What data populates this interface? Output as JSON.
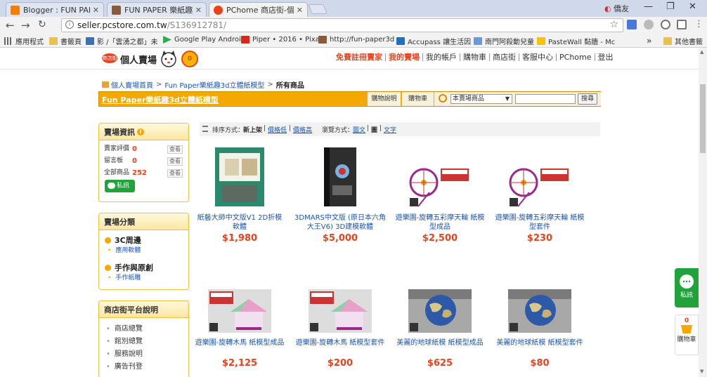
{
  "browser": {
    "tabs": [
      {
        "title": "Blogger : FUN PAPER 紙",
        "favicon_color": "#f57d00",
        "active": false
      },
      {
        "title": "FUN PAPER 樂紙趣/紙立",
        "favicon_color": "#8a5a3a",
        "active": false
      },
      {
        "title": "PChome 商店街-個人賣",
        "favicon_color": "#e8431c",
        "active": true
      }
    ],
    "user_label": "僑友",
    "url_host": "seller.pcstore.com.tw",
    "url_path": "/S136912781/",
    "bookmarks": [
      {
        "label": "應用程式",
        "icon": "apps-icon"
      },
      {
        "label": "書籤頁",
        "icon": "folder-icon"
      },
      {
        "label": "影 /「雲湧之都」未",
        "icon": "page-icon"
      },
      {
        "label": "Google Play Androi",
        "icon": "play-icon"
      },
      {
        "label": "Piper • 2016 • Pixar",
        "icon": "youtube-icon"
      },
      {
        "label": "http://fun-paper3d",
        "icon": "page-icon"
      },
      {
        "label": "Accupass 讓生活因",
        "icon": "page-icon"
      },
      {
        "label": "南門阿殺動兒童",
        "icon": "page-icon"
      },
      {
        "label": "PasteWall 黏牆 - Mc",
        "icon": "page-icon"
      },
      {
        "label": "其他書籤",
        "icon": "folder-icon"
      }
    ]
  },
  "site": {
    "logo_badge": "商店街",
    "logo_text": "個人賣場",
    "logo_zero": "0",
    "topnav": [
      {
        "label": "免費註冊賣家",
        "highlight": true
      },
      {
        "label": "我的賣場",
        "highlight": true
      },
      {
        "label": "我的帳戶",
        "highlight": false
      },
      {
        "label": "購物車",
        "highlight": false
      },
      {
        "label": "商店街",
        "highlight": false
      },
      {
        "label": "客服中心",
        "highlight": false
      },
      {
        "label": "PChome",
        "highlight": false
      },
      {
        "label": "登出",
        "highlight": false
      }
    ],
    "breadcrumb": {
      "home": "個人賣場首頁",
      "store": "Fun Paper樂紙趣3d立體紙模型",
      "current": "所有商品"
    },
    "store_name": "Fun Paper樂紙趣3d立體紙模型",
    "store_buttons": {
      "guide": "購物說明",
      "cart": "購物車"
    },
    "search": {
      "scope": "本賣場商品",
      "button": "搜尋"
    }
  },
  "sidebar": {
    "store_info": {
      "title": "賣場資訊",
      "rows": [
        {
          "label": "賣家評價",
          "value": "0",
          "action": "查看"
        },
        {
          "label": "留言板",
          "value": "0",
          "action": "查看"
        },
        {
          "label": "全部商品",
          "value": "252",
          "action": "查看"
        }
      ],
      "message_button": "私訊"
    },
    "categories": {
      "title": "賣場分類",
      "groups": [
        {
          "name": "3C周邊",
          "subs": [
            "應用軟體"
          ]
        },
        {
          "name": "手作與原創",
          "subs": [
            "手作紙雕"
          ]
        }
      ]
    },
    "platform": {
      "title": "商店街平台說明",
      "items": [
        "商店總覽",
        "館別總覽",
        "服務說明",
        "廣告刊登"
      ]
    }
  },
  "sortbar": {
    "sort_label": "排序方式：",
    "sort_current": "新上架",
    "sort_low": "價格低",
    "sort_high": "價格高",
    "view_label": "瀏覽方式：",
    "view_text_img": "圖文",
    "view_img": "圖",
    "view_text": "文字"
  },
  "products": [
    {
      "name": "紙藝大師中文版V1 2D折模軟體",
      "price": "$1,980",
      "image": "box-software-green"
    },
    {
      "name": "3DMARS中文版 (原日本六角大王V6) 3D建模軟體",
      "price": "$5,000",
      "image": "box-software-dark"
    },
    {
      "name": "遊樂園-旋轉五彩摩天輪 紙模型成品",
      "price": "$2,500",
      "image": "ferris-wheel"
    },
    {
      "name": "遊樂園-旋轉五彩摩天輪 紙模型套件",
      "price": "$230",
      "image": "ferris-wheel"
    },
    {
      "name": "遊樂園-旋轉木馬 紙模型成品",
      "price": "$2,125",
      "image": "carousel"
    },
    {
      "name": "遊樂園-旋轉木馬 紙模型套件",
      "price": "$200",
      "image": "carousel"
    },
    {
      "name": "美麗的地球紙模 紙模型成品",
      "price": "$625",
      "image": "globe"
    },
    {
      "name": "美麗的地球紙模 紙模型套件",
      "price": "$80",
      "image": "globe"
    }
  ],
  "floating": {
    "message_label": "私訊",
    "cart_count": "0",
    "cart_label": "購物車"
  }
}
